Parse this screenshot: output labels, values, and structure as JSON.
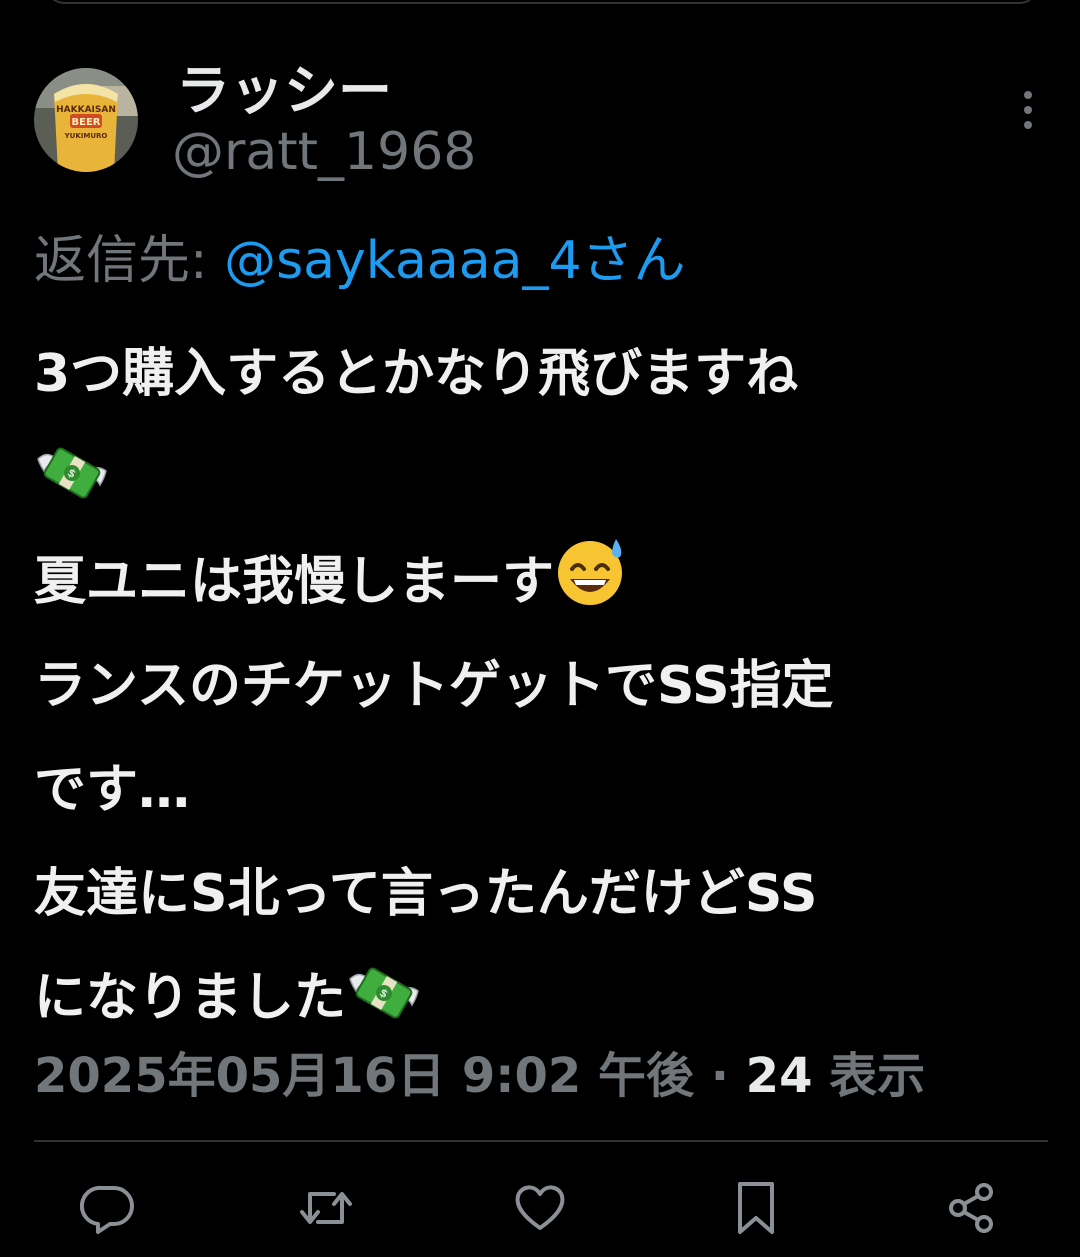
{
  "tweet": {
    "display_name": "ラッシー",
    "handle": "@ratt_1968",
    "reply_prefix": "返信先: ",
    "reply_mention": "@saykaaaa_4さん",
    "lines": [
      "3つ購入するとかなり飛びますね",
      "",
      "夏ユニは我慢しまーす",
      "ランスのチケットゲットでSS指定",
      "です…",
      "友達にS北って言ったんだけどSS",
      "になりました"
    ],
    "emojis": {
      "line1": "money-with-wings",
      "line2": "grinning-sweat",
      "line6": "money-with-wings"
    },
    "timestamp": "2025年05月16日 9:02 午後 · ",
    "views_count": "24",
    "views_label": " 表示"
  },
  "avatar": {
    "text_top": "HAKKAISAN",
    "text_mid": "BEER",
    "text_bottom": "YUKIMURO"
  },
  "actions": [
    "reply-icon",
    "retweet-icon",
    "like-icon",
    "bookmark-icon",
    "share-icon"
  ],
  "colors": {
    "background": "#000000",
    "text": "#e7e9ea",
    "muted": "#71767b",
    "accent": "#1d9bf0",
    "divider": "#2f3336"
  }
}
